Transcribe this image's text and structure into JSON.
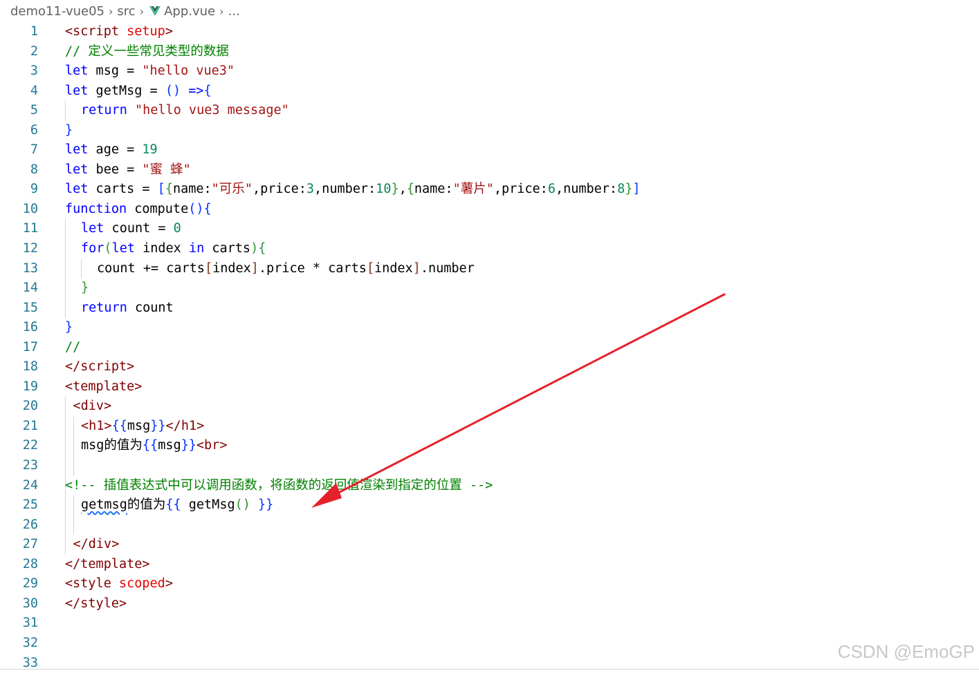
{
  "breadcrumb": {
    "project": "demo11-vue05",
    "folder": "src",
    "file": "App.vue",
    "ellipsis": "...",
    "separator_icon": "chevron-right-icon",
    "file_icon": "vue-icon"
  },
  "lines": [
    [
      {
        "t": "<",
        "c": "tag"
      },
      {
        "t": "script",
        "c": "tag"
      },
      {
        "t": " "
      },
      {
        "t": "setup",
        "c": "attr"
      },
      {
        "t": ">",
        "c": "tag"
      }
    ],
    [
      {
        "t": "// 定义一些常见类型的数据",
        "c": "cm"
      }
    ],
    [
      {
        "t": "let",
        "c": "kw"
      },
      {
        "t": " msg = "
      },
      {
        "t": "\"hello vue3\"",
        "c": "str"
      }
    ],
    [
      {
        "t": "let",
        "c": "kw"
      },
      {
        "t": " getMsg = "
      },
      {
        "t": "()",
        "c": "b1"
      },
      {
        "t": " "
      },
      {
        "t": "=>",
        "c": "kw"
      },
      {
        "t": "{",
        "c": "b1"
      }
    ],
    [
      {
        "t": "return",
        "c": "kw"
      },
      {
        "t": " "
      },
      {
        "t": "\"hello vue3 message\"",
        "c": "str"
      }
    ],
    [
      {
        "t": "}",
        "c": "b1"
      }
    ],
    [
      {
        "t": "let",
        "c": "kw"
      },
      {
        "t": " age = "
      },
      {
        "t": "19",
        "c": "num"
      }
    ],
    [
      {
        "t": "let",
        "c": "kw"
      },
      {
        "t": " bee = "
      },
      {
        "t": "\"蜜 蜂\"",
        "c": "str"
      }
    ],
    [
      {
        "t": "let",
        "c": "kw"
      },
      {
        "t": " carts = "
      },
      {
        "t": "[",
        "c": "b1"
      },
      {
        "t": "{",
        "c": "b2"
      },
      {
        "t": "name:"
      },
      {
        "t": "\"可乐\"",
        "c": "str"
      },
      {
        "t": ",price:"
      },
      {
        "t": "3",
        "c": "num"
      },
      {
        "t": ",number:"
      },
      {
        "t": "10",
        "c": "num"
      },
      {
        "t": "}",
        "c": "b2"
      },
      {
        "t": ","
      },
      {
        "t": "{",
        "c": "b2"
      },
      {
        "t": "name:"
      },
      {
        "t": "\"薯片\"",
        "c": "str"
      },
      {
        "t": ",price:"
      },
      {
        "t": "6",
        "c": "num"
      },
      {
        "t": ",number:"
      },
      {
        "t": "8",
        "c": "num"
      },
      {
        "t": "}",
        "c": "b2"
      },
      {
        "t": "]",
        "c": "b1"
      }
    ],
    [
      {
        "t": "function",
        "c": "kw"
      },
      {
        "t": " compute"
      },
      {
        "t": "()",
        "c": "b1"
      },
      {
        "t": "{",
        "c": "b1"
      }
    ],
    [
      {
        "t": "let",
        "c": "kw"
      },
      {
        "t": " count = "
      },
      {
        "t": "0",
        "c": "num"
      }
    ],
    [
      {
        "t": "for",
        "c": "kw"
      },
      {
        "t": "(",
        "c": "b2"
      },
      {
        "t": "let",
        "c": "kw"
      },
      {
        "t": " index "
      },
      {
        "t": "in",
        "c": "kw"
      },
      {
        "t": " carts"
      },
      {
        "t": ")",
        "c": "b2"
      },
      {
        "t": "{",
        "c": "b2"
      }
    ],
    [
      {
        "t": "count += carts"
      },
      {
        "t": "[",
        "c": "b3"
      },
      {
        "t": "index"
      },
      {
        "t": "]",
        "c": "b3"
      },
      {
        "t": ".price * carts"
      },
      {
        "t": "[",
        "c": "b3"
      },
      {
        "t": "index"
      },
      {
        "t": "]",
        "c": "b3"
      },
      {
        "t": ".number"
      }
    ],
    [
      {
        "t": "}",
        "c": "b2"
      }
    ],
    [
      {
        "t": "return",
        "c": "kw"
      },
      {
        "t": " count"
      }
    ],
    [
      {
        "t": "}",
        "c": "b1"
      }
    ],
    [
      {
        "t": "//",
        "c": "cm"
      }
    ],
    [
      {
        "t": "</",
        "c": "tag"
      },
      {
        "t": "script",
        "c": "tag"
      },
      {
        "t": ">",
        "c": "tag"
      }
    ],
    [
      {
        "t": "<",
        "c": "tag"
      },
      {
        "t": "template",
        "c": "tag"
      },
      {
        "t": ">",
        "c": "tag"
      }
    ],
    [
      {
        "t": "<",
        "c": "tag"
      },
      {
        "t": "div",
        "c": "tag"
      },
      {
        "t": ">",
        "c": "tag"
      }
    ],
    [
      {
        "t": "<",
        "c": "tag"
      },
      {
        "t": "h1",
        "c": "tag"
      },
      {
        "t": ">",
        "c": "tag"
      },
      {
        "t": "{{",
        "c": "b1"
      },
      {
        "t": "msg"
      },
      {
        "t": "}}",
        "c": "b1"
      },
      {
        "t": "</",
        "c": "tag"
      },
      {
        "t": "h1",
        "c": "tag"
      },
      {
        "t": ">",
        "c": "tag"
      }
    ],
    [
      {
        "t": "msg的值为"
      },
      {
        "t": "{{",
        "c": "b1"
      },
      {
        "t": "msg"
      },
      {
        "t": "}}",
        "c": "b1"
      },
      {
        "t": "<",
        "c": "tag"
      },
      {
        "t": "br",
        "c": "tag"
      },
      {
        "t": ">",
        "c": "tag"
      }
    ],
    [],
    [
      {
        "t": "<!-- 插值表达式中可以调用函数，将函数的返回值渲染到指定的位置 -->",
        "c": "cm"
      }
    ],
    [
      {
        "t": "getmsg",
        "c": "squig"
      },
      {
        "t": "的值为"
      },
      {
        "t": "{{",
        "c": "b1"
      },
      {
        "t": " getMsg"
      },
      {
        "t": "()",
        "c": "b2"
      },
      {
        "t": " "
      },
      {
        "t": "}}",
        "c": "b1"
      }
    ],
    [],
    [
      {
        "t": "</",
        "c": "tag"
      },
      {
        "t": "div",
        "c": "tag"
      },
      {
        "t": ">",
        "c": "tag"
      }
    ],
    [
      {
        "t": "</",
        "c": "tag"
      },
      {
        "t": "template",
        "c": "tag"
      },
      {
        "t": ">",
        "c": "tag"
      }
    ],
    [
      {
        "t": "<",
        "c": "tag"
      },
      {
        "t": "style",
        "c": "tag"
      },
      {
        "t": " "
      },
      {
        "t": "scoped",
        "c": "attr"
      },
      {
        "t": ">",
        "c": "tag"
      }
    ],
    [
      {
        "t": "</",
        "c": "tag"
      },
      {
        "t": "style",
        "c": "tag"
      },
      {
        "t": ">",
        "c": "tag"
      }
    ],
    [],
    [],
    []
  ],
  "annotation": {
    "arrow_color": "#e5212b"
  },
  "watermark": "CSDN @EmoGP"
}
